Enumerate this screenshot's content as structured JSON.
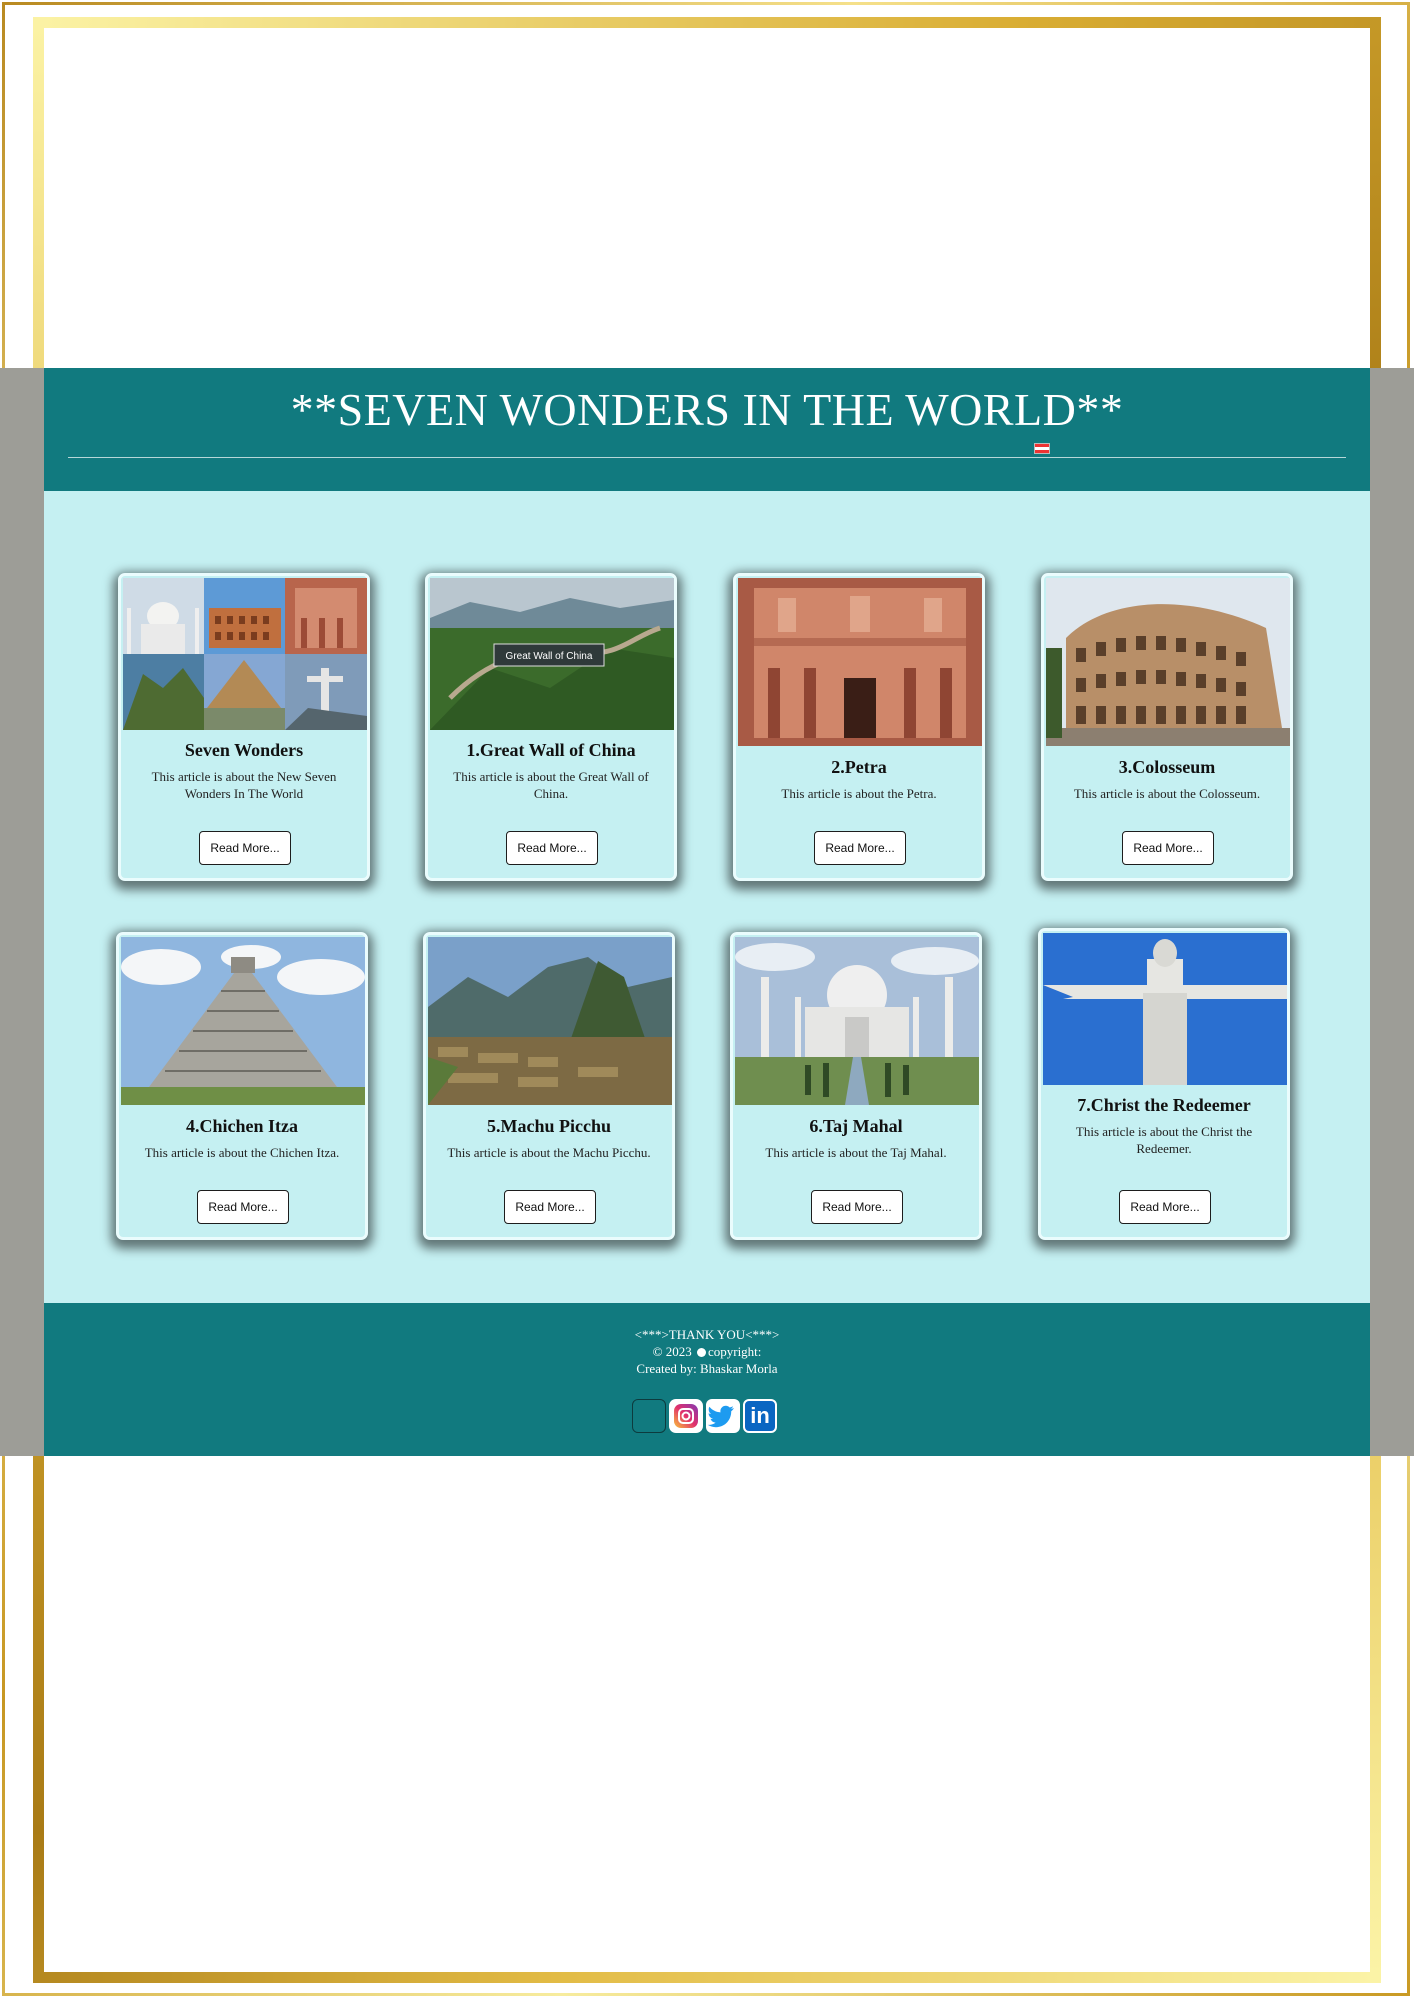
{
  "page": {
    "title": "**SEVEN WONDERS IN THE WORLD**"
  },
  "cards": [
    {
      "title": "Seven Wonders",
      "text": "This article is about the New Seven Wonders In The World",
      "button": "Read More...",
      "image": "seven-wonders-collage"
    },
    {
      "title": "1.Great Wall of China",
      "text": "This article is about the Great Wall of China.",
      "button": "Read More...",
      "image": "great-wall",
      "image_caption": "Great Wall of China"
    },
    {
      "title": "2.Petra",
      "text": "This article is about the Petra.",
      "button": "Read More...",
      "image": "petra"
    },
    {
      "title": "3.Colosseum",
      "text": "This article is about the Colosseum.",
      "button": "Read More...",
      "image": "colosseum"
    },
    {
      "title": "4.Chichen Itza",
      "text": "This article is about the Chichen Itza.",
      "button": "Read More...",
      "image": "chichen-itza"
    },
    {
      "title": "5.Machu Picchu",
      "text": "This article is about the Machu Picchu.",
      "button": "Read More...",
      "image": "machu-picchu"
    },
    {
      "title": "6.Taj Mahal",
      "text": "This article is about the Taj Mahal.",
      "button": "Read More...",
      "image": "taj-mahal"
    },
    {
      "title": "7.Christ the Redeemer",
      "text": "This article is about the Christ the Redeemer.",
      "button": "Read More...",
      "image": "christ-the-redeemer"
    }
  ],
  "footer": {
    "thanks": "<***>THANK YOU<***>",
    "copyright_year": "© 2023",
    "copyright_label": "copyright:",
    "created_by": "Created by: Bhaskar Morla",
    "social": [
      "facebook-icon",
      "instagram-icon",
      "twitter-icon",
      "linkedin-icon"
    ],
    "linkedin_text": "in"
  },
  "colors": {
    "teal": "#117a7f",
    "light_cyan": "#c5f0f2",
    "gold": "#d8a92c",
    "gray_band": "#9d9d97"
  }
}
